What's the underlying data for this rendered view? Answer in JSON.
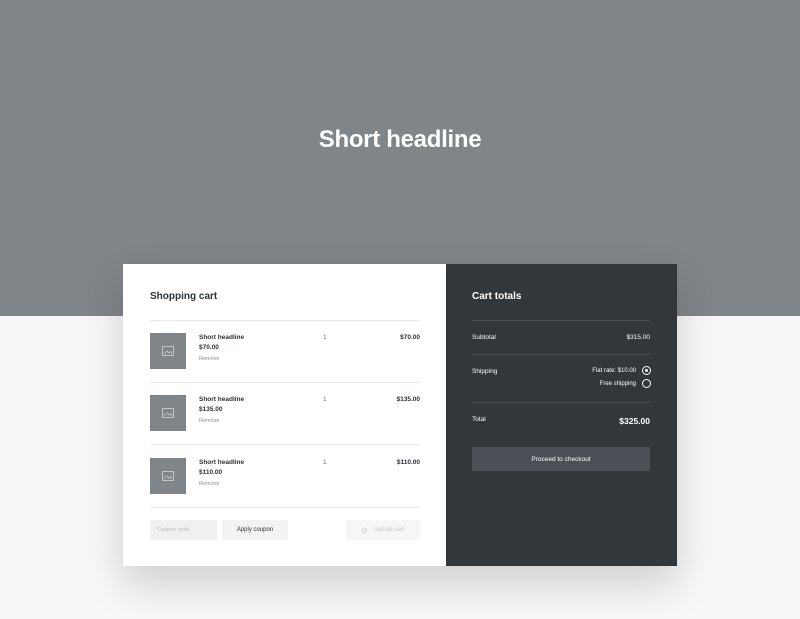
{
  "hero": {
    "title": "Short headline"
  },
  "cart": {
    "title": "Shopping cart",
    "items": [
      {
        "name": "Short headline",
        "price": "$70.00",
        "remove": "Remove",
        "quantity": "1",
        "total": "$70.00",
        "icon": "image-placeholder-icon"
      },
      {
        "name": "Short headline",
        "price": "$135.00",
        "remove": "Remove",
        "quantity": "1",
        "total": "$135.00",
        "icon": "image-placeholder-icon"
      },
      {
        "name": "Short headline",
        "price": "$110.00",
        "remove": "Remove",
        "quantity": "1",
        "total": "$110.00",
        "icon": "image-placeholder-icon"
      }
    ],
    "coupon_placeholder": "Coupon code",
    "apply_coupon_label": "Apply coupon",
    "update_cart_label": "Update cart",
    "update_icon": "refresh-icon"
  },
  "totals": {
    "title": "Cart totals",
    "subtotal_label": "Subtotal",
    "subtotal_value": "$315.00",
    "shipping_label": "Shipping",
    "shipping_options": [
      {
        "label": "Flat rate: $10.00",
        "selected": true
      },
      {
        "label": "Free shipping",
        "selected": false
      }
    ],
    "total_label": "Total",
    "total_value": "$325.00",
    "checkout_label": "Proceed to checkout"
  },
  "colors": {
    "hero_bg": "#80858a",
    "panel_dark": "#32373b",
    "checkout_button": "#4a5055",
    "page_bg": "#f7f7f7"
  }
}
